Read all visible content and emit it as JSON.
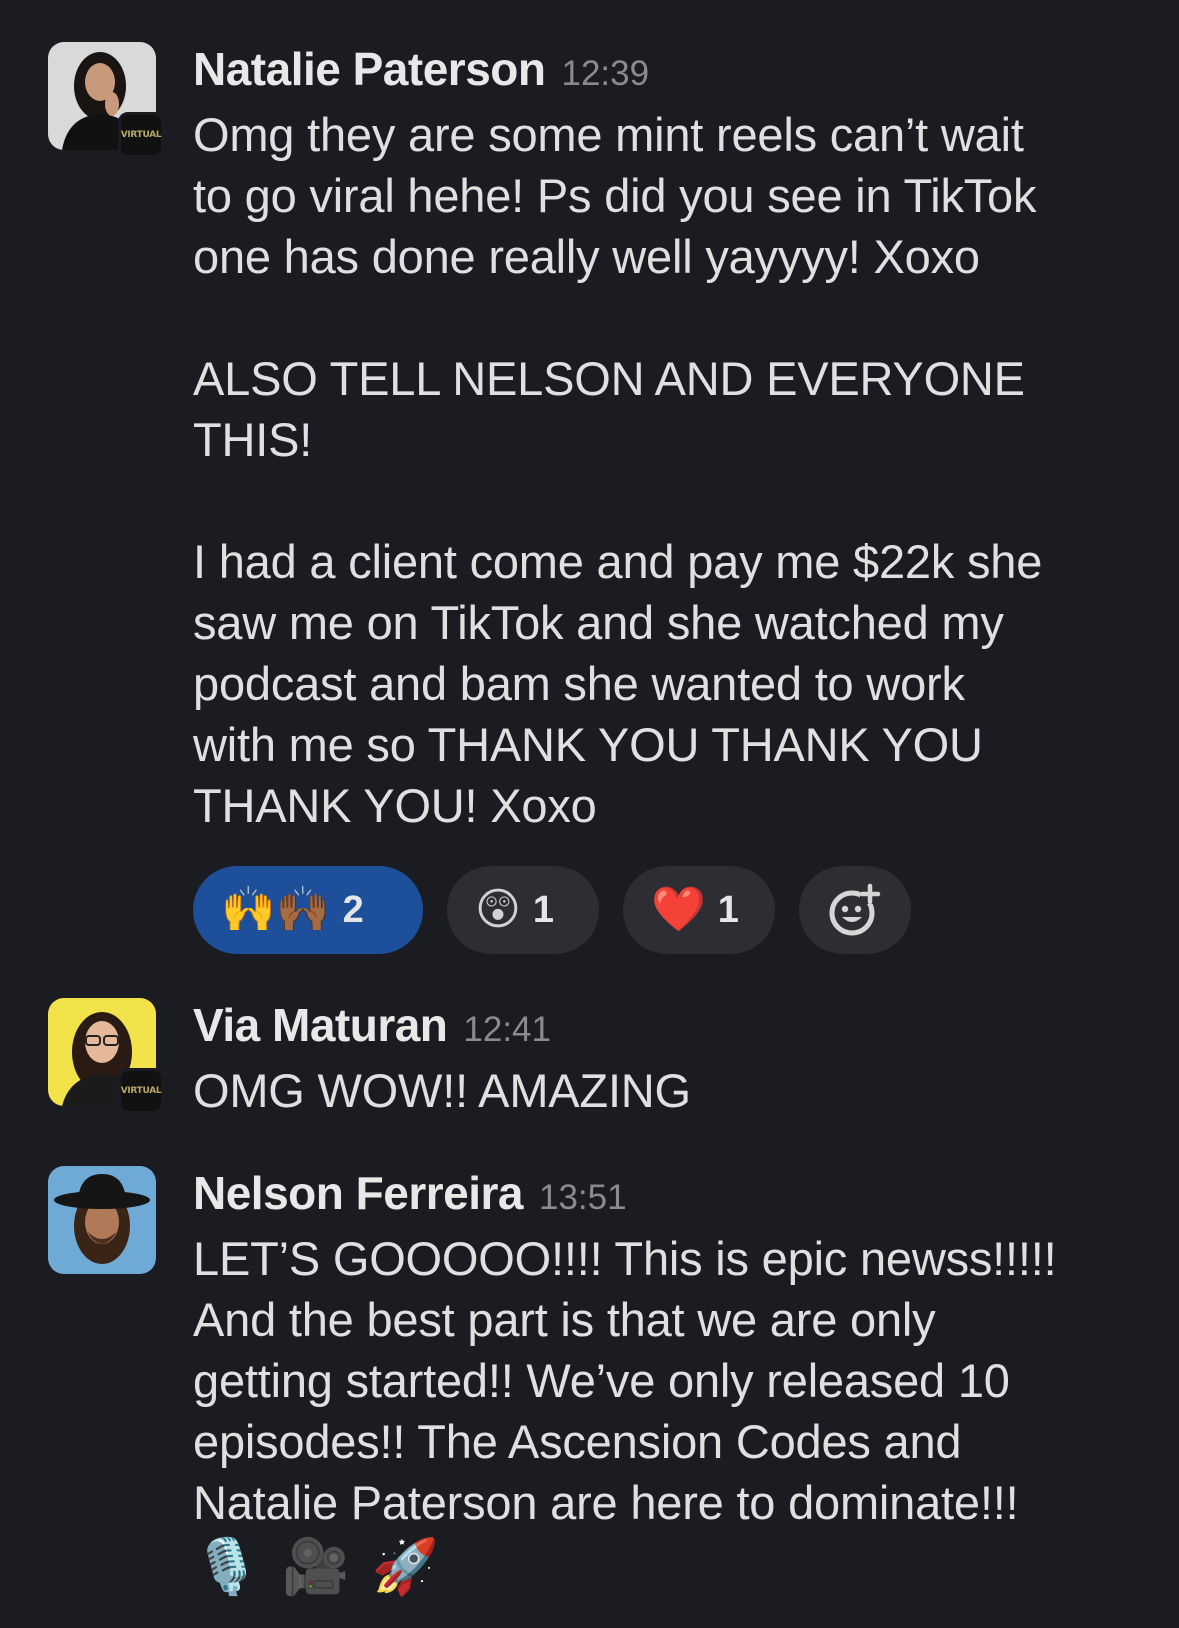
{
  "org_badge_label": "VIRTUAL",
  "messages": [
    {
      "sender": "Natalie Paterson",
      "time": "12:39",
      "text": "Omg they are some mint reels can’t wait\nto go viral hehe! Ps did you see in TikTok\none has done really well yayyyy! Xoxo\n\nALSO TELL NELSON AND EVERYONE\nTHIS!\n\nI had a client come and pay me $22k she\nsaw me on TikTok and she watched my\npodcast and bam she wanted to work\nwith me so THANK YOU THANK YOU\nTHANK YOU! Xoxo",
      "avatar_colors": {
        "bg": "#d9d9d9",
        "hair": "#1a1512",
        "skin": "#c8997a",
        "outfit": "#111111"
      },
      "reactions": [
        {
          "emoji": "🙌🙌🏾",
          "count": "2",
          "active": true
        },
        {
          "emoji": "😲",
          "count": "1",
          "active": false
        },
        {
          "emoji": "❤️",
          "count": "1",
          "active": false
        }
      ],
      "add_reaction_icon": "add-emoji-icon"
    },
    {
      "sender": "Via Maturan",
      "time": "12:41",
      "text": "OMG WOW!! AMAZING",
      "avatar_colors": {
        "bg": "#f2e34a",
        "hair": "#2a1a14",
        "skin": "#e5b899",
        "outfit": "#1b1b1b"
      }
    },
    {
      "sender": "Nelson Ferreira",
      "time": "13:51",
      "text": "LET’S GOOOOO!!!! This is epic newss!!!!!\nAnd the best part is that we are only\ngetting started!! We’ve only released 10\nepisodes!! The Ascension Codes and\nNatalie Paterson are here to dominate!!!",
      "avatar_colors": {
        "bg": "#6fa9d6",
        "hair": "#3a2418",
        "skin": "#b07a58",
        "hat": "#151515"
      },
      "trailing_emoji": [
        "🎙️",
        "🎥",
        "🚀"
      ]
    }
  ]
}
